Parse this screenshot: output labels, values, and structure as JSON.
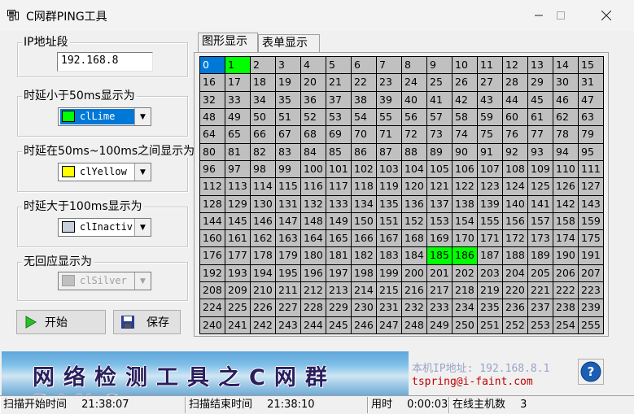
{
  "window": {
    "title": "C网群PING工具"
  },
  "ip_group": {
    "label": "IP地址段",
    "value": "192.168.8"
  },
  "fast_group": {
    "label": "时延小于50ms显示为",
    "color_name": "clLime",
    "swatch": "#00ff00"
  },
  "mid_group": {
    "label": "时延在50ms~100ms之间显示为",
    "color_name": "clYellow",
    "swatch": "#ffff00"
  },
  "slow_group": {
    "label": "时延大于100ms显示为",
    "color_name": "clInactiv",
    "swatch": "#c7d0dc"
  },
  "none_group": {
    "label": "无回应显示为",
    "color_name": "clSilver",
    "swatch": "#c0c0c0"
  },
  "buttons": {
    "start": "开始",
    "save": "保存"
  },
  "tabs": {
    "graph": "图形显示",
    "table": "表单显示"
  },
  "grid": {
    "count": 256,
    "default_color": "#c0c0c0",
    "selected_cell": 0,
    "selected_color": "#0078d7",
    "online_cells": [
      1,
      185,
      186
    ],
    "online_color": "#00ff00"
  },
  "banner": {
    "text": "网络检测工具之C网群PING"
  },
  "info": {
    "local_ip": "本机IP地址: 192.168.8.1",
    "email": "tspring@i-faint.com"
  },
  "status": {
    "scan_start_label": "扫描开始时间",
    "scan_start": "21:38:07",
    "scan_end_label": "扫描结束时间",
    "scan_end": "21:38:10",
    "elapsed_label": "用时",
    "elapsed": "0:00:03",
    "online_label": "在线主机数",
    "online": "3"
  },
  "icons": {
    "app": "app-icon",
    "minimize": "minimize-icon",
    "maximize": "maximize-icon",
    "close": "close-icon",
    "play": "play-icon",
    "save": "floppy-icon",
    "help": "help-icon"
  }
}
